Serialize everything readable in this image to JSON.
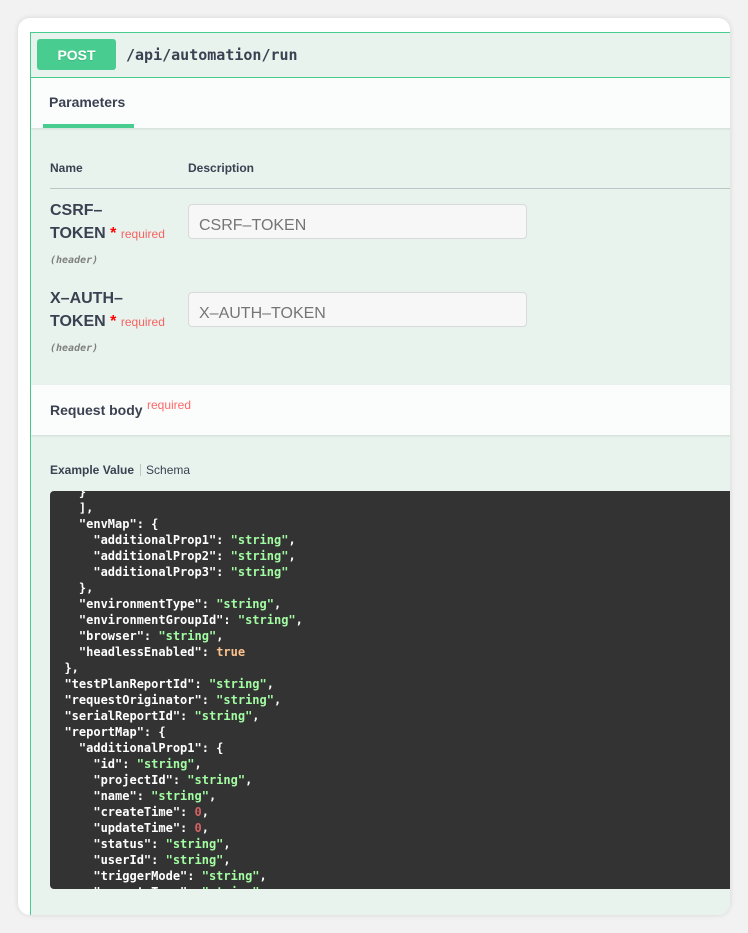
{
  "operation": {
    "method": "POST",
    "path": "/api/automation/run"
  },
  "parameters_tab": {
    "label": "Parameters"
  },
  "table": {
    "name_header": "Name",
    "description_header": "Description"
  },
  "params": [
    {
      "name_line1": "CSRF–",
      "name_line2": "TOKEN",
      "required_star": "*",
      "required_label": "required",
      "in": "(header)",
      "placeholder": "CSRF–TOKEN"
    },
    {
      "name_line1": "X–AUTH–",
      "name_line2": "TOKEN",
      "required_star": "*",
      "required_label": "required",
      "in": "(header)",
      "placeholder": "X–AUTH–TOKEN"
    }
  ],
  "request_body": {
    "title": "Request body",
    "required_label": "required"
  },
  "example_tabs": {
    "example_value": "Example Value",
    "schema": "Schema"
  },
  "colors": {
    "post_green": "#49cc90",
    "block_bg": "#e8f3ee",
    "code_bg": "#333333",
    "string": "#a2fca2",
    "boolean": "#fcc28c",
    "number": "#d36363"
  },
  "code_lines": [
    {
      "indent": "    ",
      "parts": [
        {
          "t": "k",
          "v": "}"
        }
      ]
    },
    {
      "indent": "    ",
      "parts": [
        {
          "t": "k",
          "v": "],"
        }
      ]
    },
    {
      "indent": "    ",
      "parts": [
        {
          "t": "k",
          "v": "\"envMap\": {"
        }
      ]
    },
    {
      "indent": "      ",
      "parts": [
        {
          "t": "k",
          "v": "\"additionalProp1\": "
        },
        {
          "t": "s",
          "v": "\"string\""
        },
        {
          "t": "k",
          "v": ","
        }
      ]
    },
    {
      "indent": "      ",
      "parts": [
        {
          "t": "k",
          "v": "\"additionalProp2\": "
        },
        {
          "t": "s",
          "v": "\"string\""
        },
        {
          "t": "k",
          "v": ","
        }
      ]
    },
    {
      "indent": "      ",
      "parts": [
        {
          "t": "k",
          "v": "\"additionalProp3\": "
        },
        {
          "t": "s",
          "v": "\"string\""
        }
      ]
    },
    {
      "indent": "    ",
      "parts": [
        {
          "t": "k",
          "v": "},"
        }
      ]
    },
    {
      "indent": "    ",
      "parts": [
        {
          "t": "k",
          "v": "\"environmentType\": "
        },
        {
          "t": "s",
          "v": "\"string\""
        },
        {
          "t": "k",
          "v": ","
        }
      ]
    },
    {
      "indent": "    ",
      "parts": [
        {
          "t": "k",
          "v": "\"environmentGroupId\": "
        },
        {
          "t": "s",
          "v": "\"string\""
        },
        {
          "t": "k",
          "v": ","
        }
      ]
    },
    {
      "indent": "    ",
      "parts": [
        {
          "t": "k",
          "v": "\"browser\": "
        },
        {
          "t": "s",
          "v": "\"string\""
        },
        {
          "t": "k",
          "v": ","
        }
      ]
    },
    {
      "indent": "    ",
      "parts": [
        {
          "t": "k",
          "v": "\"headlessEnabled\": "
        },
        {
          "t": "b",
          "v": "true"
        }
      ]
    },
    {
      "indent": "  ",
      "parts": [
        {
          "t": "k",
          "v": "},"
        }
      ]
    },
    {
      "indent": "  ",
      "parts": [
        {
          "t": "k",
          "v": "\"testPlanReportId\": "
        },
        {
          "t": "s",
          "v": "\"string\""
        },
        {
          "t": "k",
          "v": ","
        }
      ]
    },
    {
      "indent": "  ",
      "parts": [
        {
          "t": "k",
          "v": "\"requestOriginator\": "
        },
        {
          "t": "s",
          "v": "\"string\""
        },
        {
          "t": "k",
          "v": ","
        }
      ]
    },
    {
      "indent": "  ",
      "parts": [
        {
          "t": "k",
          "v": "\"serialReportId\": "
        },
        {
          "t": "s",
          "v": "\"string\""
        },
        {
          "t": "k",
          "v": ","
        }
      ]
    },
    {
      "indent": "  ",
      "parts": [
        {
          "t": "k",
          "v": "\"reportMap\": {"
        }
      ]
    },
    {
      "indent": "    ",
      "parts": [
        {
          "t": "k",
          "v": "\"additionalProp1\": {"
        }
      ]
    },
    {
      "indent": "      ",
      "parts": [
        {
          "t": "k",
          "v": "\"id\": "
        },
        {
          "t": "s",
          "v": "\"string\""
        },
        {
          "t": "k",
          "v": ","
        }
      ]
    },
    {
      "indent": "      ",
      "parts": [
        {
          "t": "k",
          "v": "\"projectId\": "
        },
        {
          "t": "s",
          "v": "\"string\""
        },
        {
          "t": "k",
          "v": ","
        }
      ]
    },
    {
      "indent": "      ",
      "parts": [
        {
          "t": "k",
          "v": "\"name\": "
        },
        {
          "t": "s",
          "v": "\"string\""
        },
        {
          "t": "k",
          "v": ","
        }
      ]
    },
    {
      "indent": "      ",
      "parts": [
        {
          "t": "k",
          "v": "\"createTime\": "
        },
        {
          "t": "n",
          "v": "0"
        },
        {
          "t": "k",
          "v": ","
        }
      ]
    },
    {
      "indent": "      ",
      "parts": [
        {
          "t": "k",
          "v": "\"updateTime\": "
        },
        {
          "t": "n",
          "v": "0"
        },
        {
          "t": "k",
          "v": ","
        }
      ]
    },
    {
      "indent": "      ",
      "parts": [
        {
          "t": "k",
          "v": "\"status\": "
        },
        {
          "t": "s",
          "v": "\"string\""
        },
        {
          "t": "k",
          "v": ","
        }
      ]
    },
    {
      "indent": "      ",
      "parts": [
        {
          "t": "k",
          "v": "\"userId\": "
        },
        {
          "t": "s",
          "v": "\"string\""
        },
        {
          "t": "k",
          "v": ","
        }
      ]
    },
    {
      "indent": "      ",
      "parts": [
        {
          "t": "k",
          "v": "\"triggerMode\": "
        },
        {
          "t": "s",
          "v": "\"string\""
        },
        {
          "t": "k",
          "v": ","
        }
      ]
    },
    {
      "indent": "      ",
      "parts": [
        {
          "t": "k",
          "v": "\"executeType\": "
        },
        {
          "t": "s",
          "v": "\"string\""
        },
        {
          "t": "k",
          "v": ","
        }
      ]
    }
  ]
}
